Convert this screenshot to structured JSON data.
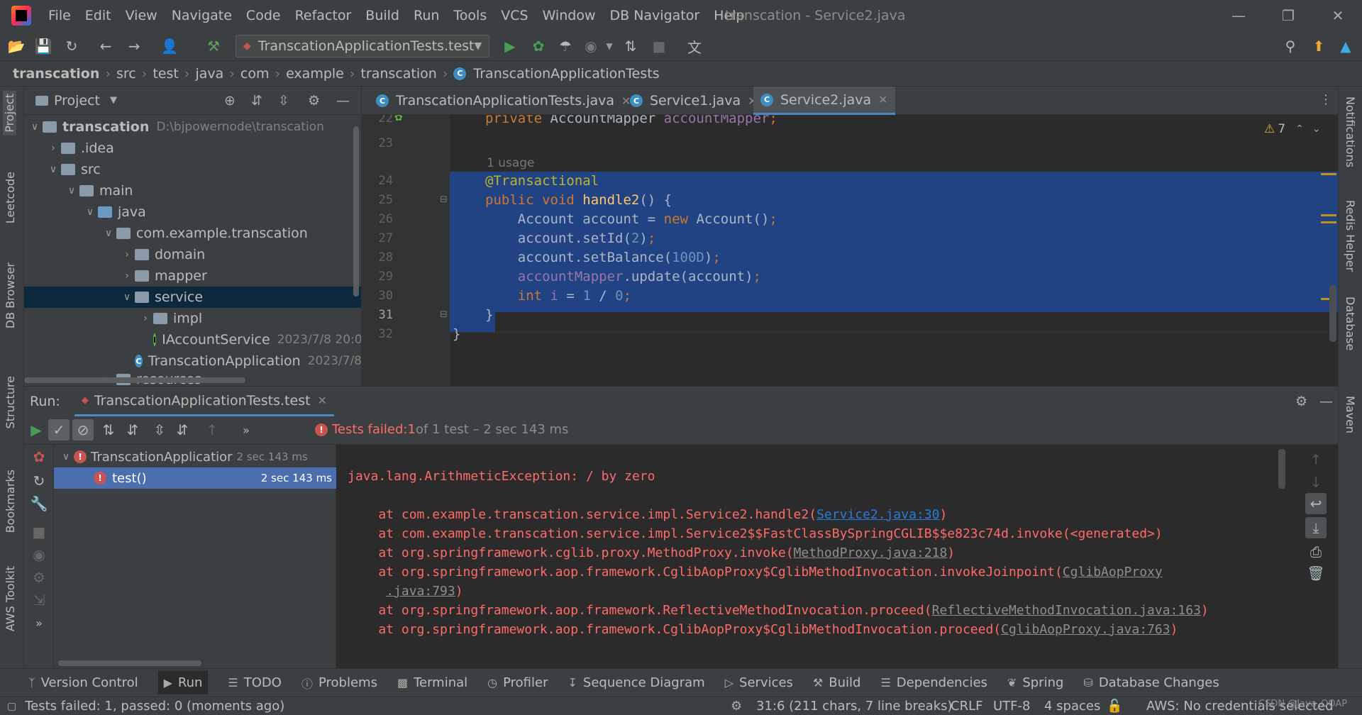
{
  "menu": [
    "File",
    "Edit",
    "View",
    "Navigate",
    "Code",
    "Refactor",
    "Build",
    "Run",
    "Tools",
    "VCS",
    "Window",
    "DB Navigator",
    "Help"
  ],
  "window_title": "transcation - Service2.java",
  "run_config": "TranscationApplicationTests.test",
  "breadcrumb": [
    "transcation",
    "src",
    "test",
    "java",
    "com",
    "example",
    "transcation",
    "TranscationApplicationTests"
  ],
  "left_strip": [
    "Project",
    "Leetcode",
    "DB Browser",
    "Structure",
    "Bookmarks",
    "AWS Toolkit"
  ],
  "right_strip": [
    "Notifications",
    "Redis Helper",
    "Database",
    "Maven"
  ],
  "project": {
    "title": "Project",
    "tree": [
      {
        "label": "transcation",
        "extra": "D:\\bjpowernode\\transcation"
      },
      {
        "label": ".idea",
        "extra": ""
      },
      {
        "label": "src",
        "extra": ""
      },
      {
        "label": "main",
        "extra": ""
      },
      {
        "label": "java",
        "extra": ""
      },
      {
        "label": "com.example.transcation",
        "extra": ""
      },
      {
        "label": "domain",
        "extra": ""
      },
      {
        "label": "mapper",
        "extra": ""
      },
      {
        "label": "service",
        "extra": ""
      },
      {
        "label": "impl",
        "extra": ""
      },
      {
        "label": "IAccountService",
        "extra": "2023/7/8 20:0"
      },
      {
        "label": "TranscationApplication",
        "extra": "2023/7/8"
      },
      {
        "label": "resources",
        "extra": ""
      }
    ]
  },
  "editor_tabs": [
    "TranscationApplicationTests.java",
    "Service1.java",
    "Service2.java"
  ],
  "editor": {
    "warnings": "7",
    "line_numbers": [
      "22",
      "23",
      "24",
      "25",
      "26",
      "27",
      "28",
      "29",
      "30",
      "31",
      "32"
    ],
    "usage_hint": "1 usage",
    "lines": {
      "l22a": "private ",
      "l22b": "AccountMapper ",
      "l22c": "accountMapper",
      "l22d": ";",
      "l24": "@Transactional",
      "l25a": "public void ",
      "l25b": "handle2",
      "l25c": "() {",
      "l26a": "    Account account = ",
      "l26b": "new ",
      "l26c": "Account()",
      "l26d": ";",
      "l27a": "    account.setId(",
      "l27b": "2",
      "l27c": ")",
      "l27d": ";",
      "l28a": "    account.setBalance(",
      "l28b": "100D",
      "l28c": ")",
      "l28d": ";",
      "l29a": "    ",
      "l29b": "accountMapper",
      "l29c": ".update(account)",
      "l29d": ";",
      "l30a": "    ",
      "l30b": "int ",
      "l30c": "i",
      "l30d": " = ",
      "l30e": "1",
      "l30f": " / ",
      "l30g": "0",
      "l30h": ";",
      "l31": "}",
      "l32": "}"
    }
  },
  "run": {
    "label": "Run:",
    "tab": "TranscationApplicationTests.test",
    "status_prefix": "Tests failed: ",
    "status_count": "1",
    "status_suffix": " of 1 test – 2 sec 143 ms",
    "tree": [
      {
        "label": "TranscationApplicatior",
        "time": "2 sec 143 ms"
      },
      {
        "label": "test()",
        "time": "2 sec 143 ms"
      }
    ]
  },
  "console": {
    "exception": "java.lang.ArithmeticException: / by zero",
    "frames": [
      {
        "text": "    at com.example.transcation.service.impl.Service2.handle2(",
        "link": "Service2.java:30",
        "tail": ")"
      },
      {
        "text": "    at com.example.transcation.service.impl.Service2$$FastClassBySpringCGLIB$$e823c74d.invoke(<generated>)",
        "link": "",
        "tail": ""
      },
      {
        "text": "    at org.springframework.cglib.proxy.MethodProxy.invoke(",
        "link": "MethodProxy.java:218",
        "tail": ")"
      },
      {
        "text": "    at org.springframework.aop.framework.CglibAopProxy$CglibMethodInvocation.invokeJoinpoint(",
        "link": "CglibAopProxy",
        "tail": ""
      },
      {
        "text": "     ",
        "link": ".java:793",
        "tail": ")"
      },
      {
        "text": "    at org.springframework.aop.framework.ReflectiveMethodInvocation.proceed(",
        "link": "ReflectiveMethodInvocation.java:163",
        "tail": ")"
      },
      {
        "text": "    at org.springframework.aop.framework.CglibAopProxy$CglibMethodInvocation.proceed(",
        "link": "CglibAopProxy.java:763",
        "tail": ")"
      }
    ]
  },
  "bottom_tabs": [
    "Version Control",
    "Run",
    "TODO",
    "Problems",
    "Terminal",
    "Profiler",
    "Sequence Diagram",
    "Services",
    "Build",
    "Dependencies",
    "Spring",
    "Database Changes"
  ],
  "status": {
    "message": "Tests failed: 1, passed: 0 (moments ago)",
    "position": "31:6 (211 chars, 7 line breaks)",
    "line_sep": "CRLF",
    "encoding": "UTF-8",
    "indent": "4 spaces",
    "aws": "AWS: No credentials selected",
    "watermark": "CSDN @Java_OOAP"
  },
  "colors": {
    "accent": "#4a88c7",
    "selection": "#214283",
    "error": "#ff6b68",
    "run_green": "#499c54"
  }
}
